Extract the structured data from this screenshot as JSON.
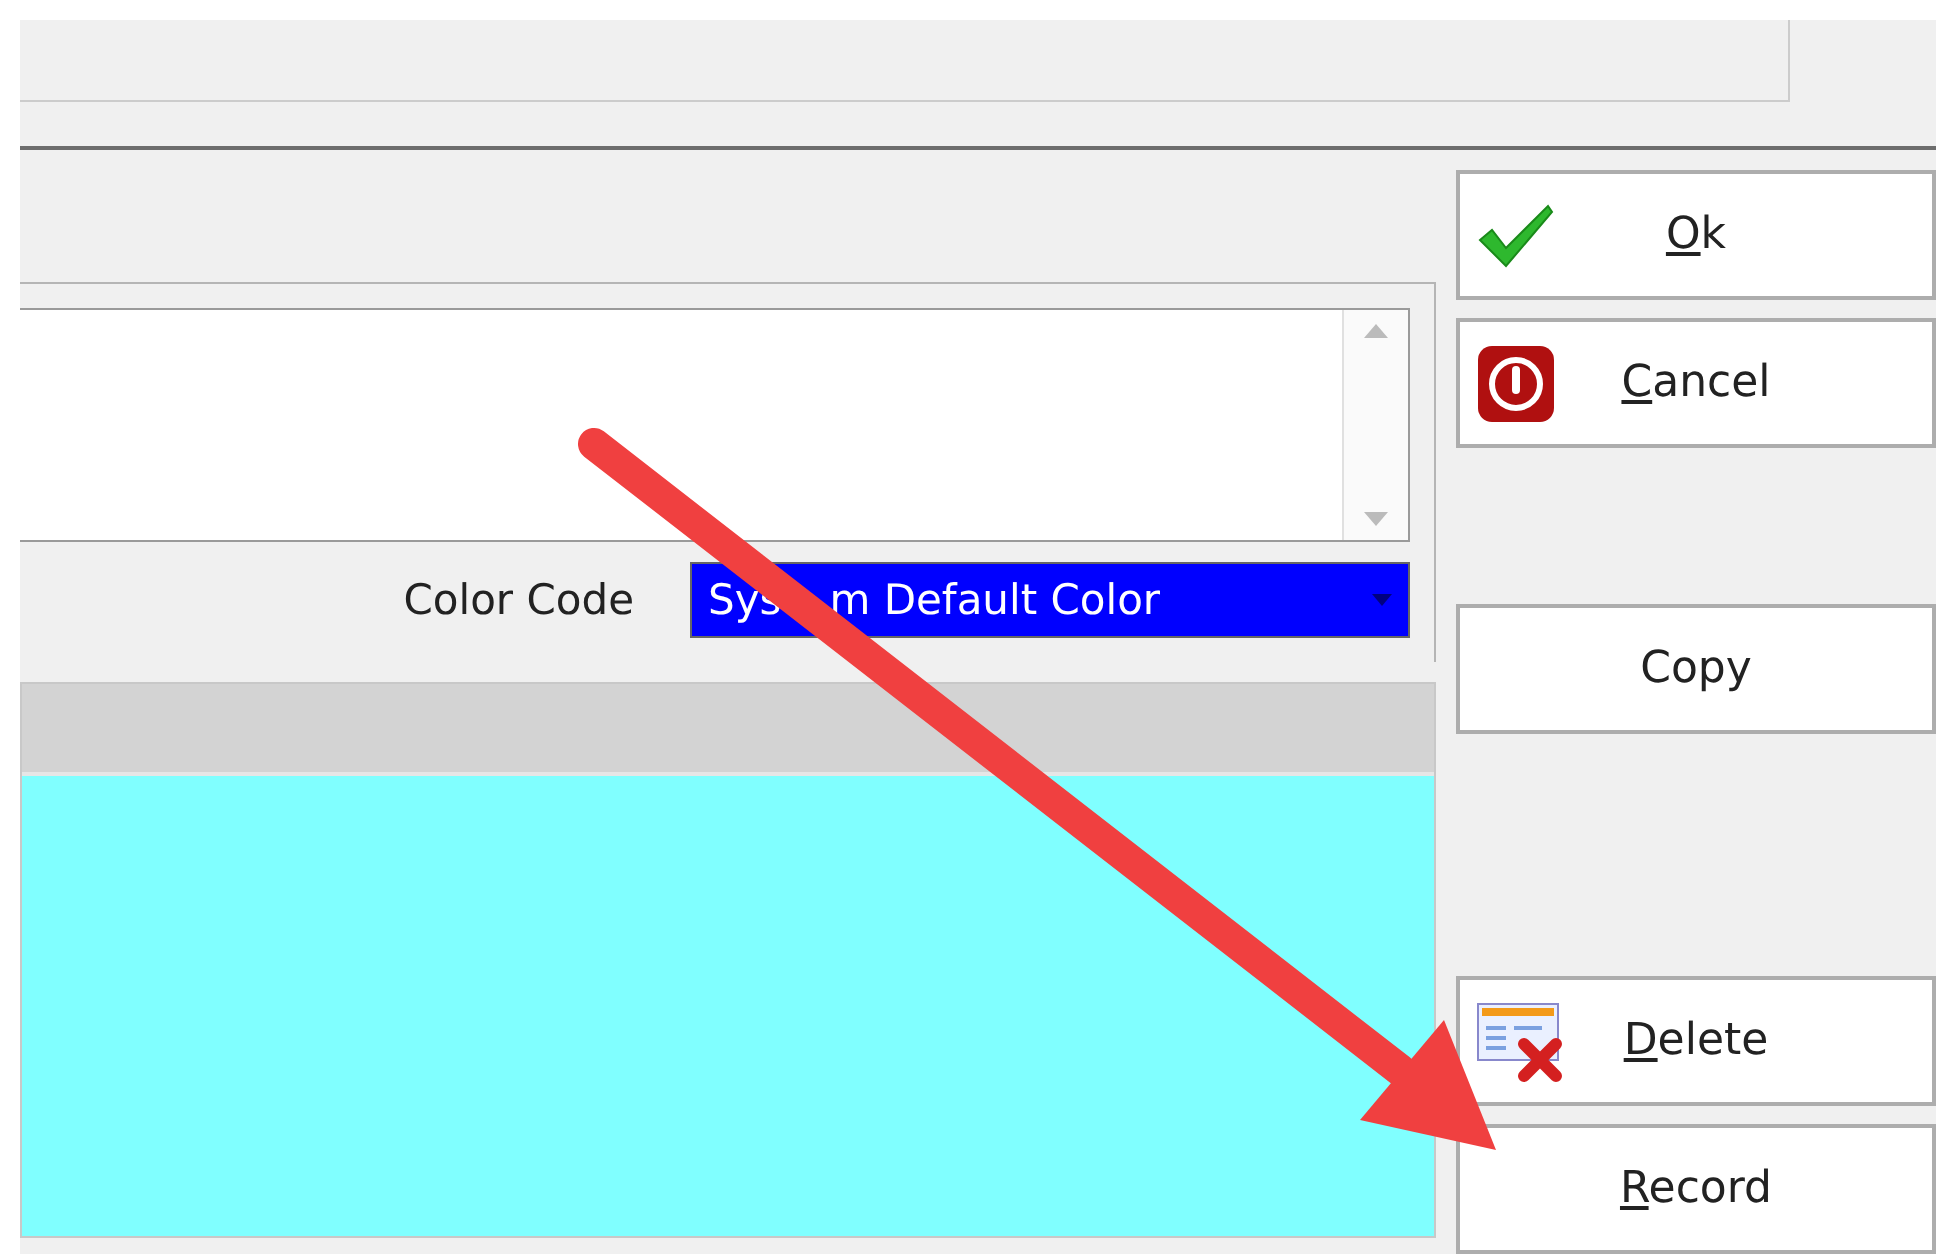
{
  "color_code": {
    "label": "Color Code",
    "value_parts": [
      "Sys",
      "m Default Color"
    ]
  },
  "grid": {
    "kind": "grid"
  },
  "buttons": [
    {
      "label": "Ok",
      "mnemonic": true
    },
    {
      "label": "Cancel",
      "mnemonic": true
    },
    {
      "label": "Copy",
      "mnemonic": false
    },
    {
      "label": "Delete",
      "mnemonic": true
    },
    {
      "label": "Record",
      "mnemonic": true
    }
  ],
  "annotation": {
    "kind": "arrow"
  }
}
